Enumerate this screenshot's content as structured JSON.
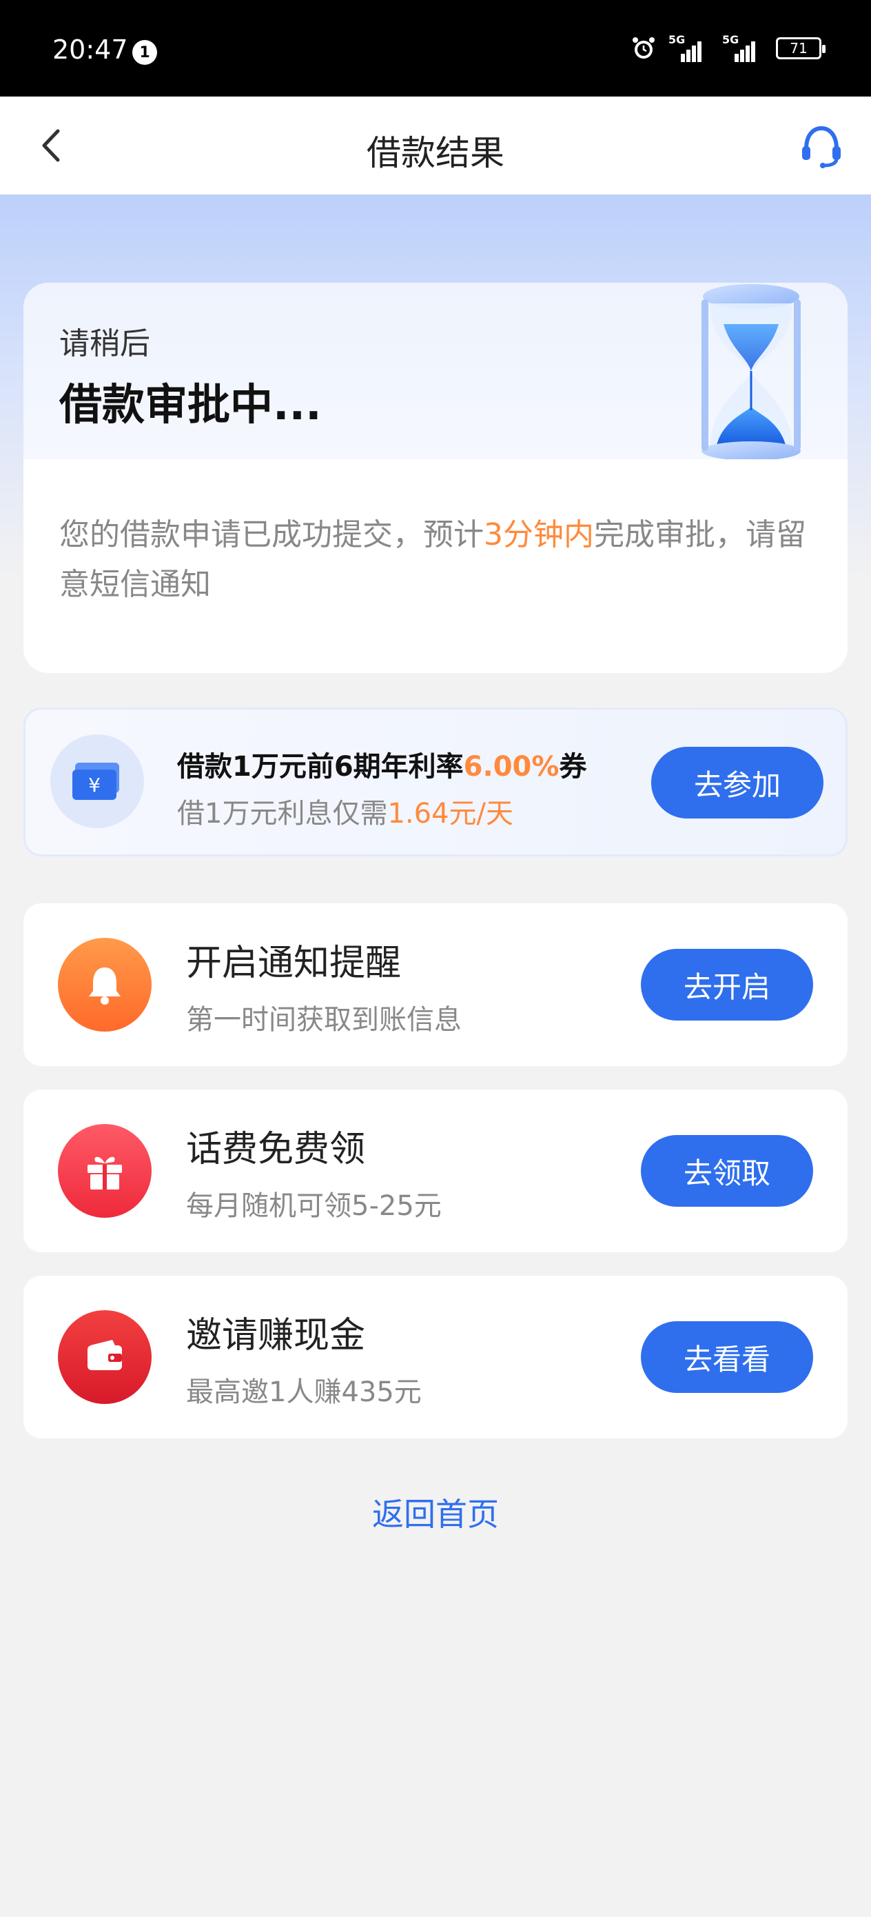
{
  "status_bar": {
    "time": "20:47",
    "notification_count": "1",
    "signal_1_label": "5G",
    "signal_2_label": "5G",
    "battery": "71"
  },
  "nav": {
    "title": "借款结果"
  },
  "status_card": {
    "subtitle": "请稍后",
    "title": "借款审批中...",
    "desc_before": "您的借款申请已成功提交，预计",
    "desc_highlight": "3分钟内",
    "desc_after": "完成审批，请留意短信通知"
  },
  "coupon": {
    "title_before": "借款1万元前6期年利率",
    "title_highlight": "6.00%",
    "title_after": "券",
    "sub_before": "借1万元利息仅需",
    "sub_highlight": "1.64元/天",
    "button": "去参加",
    "icon_symbol": "¥"
  },
  "tasks": [
    {
      "title": "开启通知提醒",
      "subtitle": "第一时间获取到账信息",
      "button": "去开启",
      "icon": "bell-icon",
      "color": "#ff7a3a"
    },
    {
      "title": "话费免费领",
      "subtitle": "每月随机可领5-25元",
      "button": "去领取",
      "icon": "gift-icon",
      "color": "#f4394a"
    },
    {
      "title": "邀请赚现金",
      "subtitle": "最高邀1人赚435元",
      "button": "去看看",
      "icon": "wallet-icon",
      "color": "#ee2a33"
    }
  ],
  "footer": {
    "back_home": "返回首页"
  },
  "colors": {
    "accent": "#2f6fee",
    "highlight": "#ff8a3d"
  }
}
